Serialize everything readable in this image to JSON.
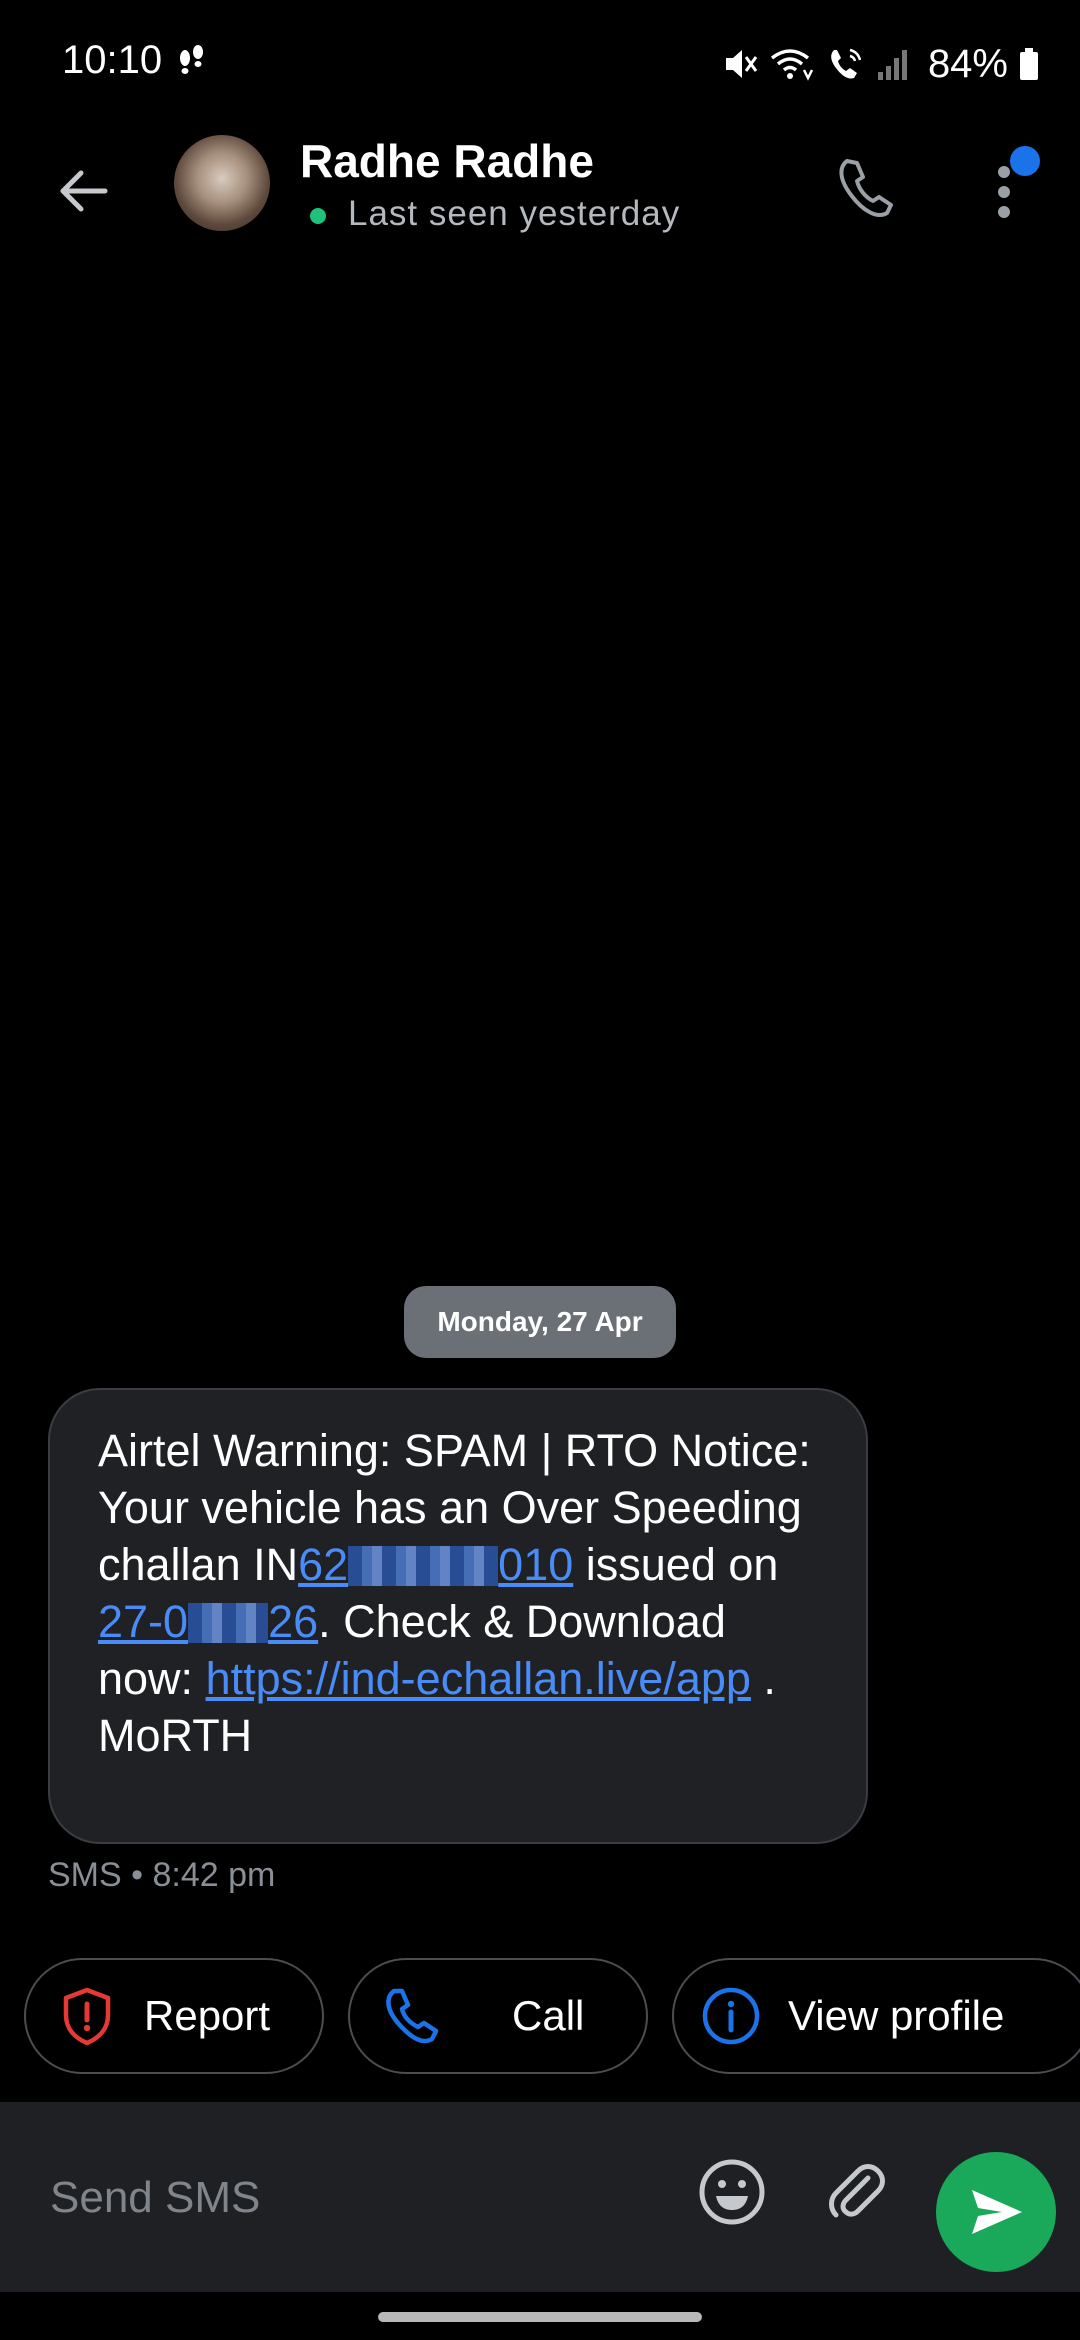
{
  "status_bar": {
    "time": "10:10",
    "battery": "84%"
  },
  "header": {
    "contact_name": "Radhe Radhe",
    "presence": "Last seen yesterday",
    "presence_color": "#1fc27a",
    "icons": [
      "back-arrow-icon",
      "phone-icon",
      "more-vert-icon"
    ]
  },
  "conversation": {
    "date_separator": "Monday, 27 Apr",
    "message": {
      "part1": "Airtel Warning: SPAM | RTO Notice: Your vehicle has an Over Speeding challan IN",
      "challan_prefix": "62",
      "challan_suffix": "010",
      "part2": " issued on ",
      "date_prefix": "27-0",
      "date_suffix": "26",
      "part3": ". Check & Download now: ",
      "link": "https://ind-echallan.live/app",
      "part4": " . MoRTH"
    },
    "meta": "SMS • 8:42 pm"
  },
  "chips": {
    "report": "Report",
    "call": "Call",
    "view_profile": "View profile"
  },
  "compose": {
    "placeholder": "Send SMS"
  },
  "colors": {
    "accent_blue": "#1a73e8",
    "send_green": "#1aa95a",
    "report_red": "#e53935"
  }
}
